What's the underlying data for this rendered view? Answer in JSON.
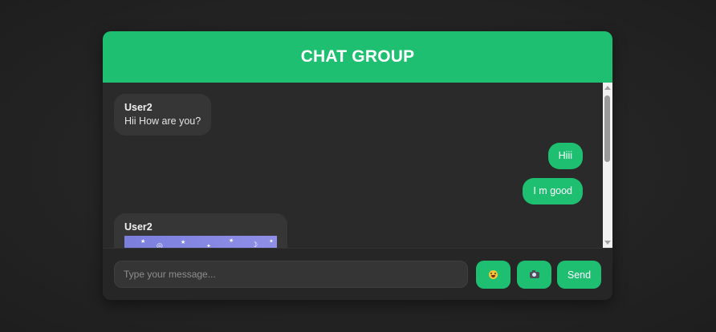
{
  "header": {
    "title": "CHAT GROUP"
  },
  "messages": [
    {
      "direction": "received",
      "sender": "User2",
      "text": "Hii How are you?"
    },
    {
      "direction": "sent",
      "text": "Hiii"
    },
    {
      "direction": "sent",
      "text": "I m good"
    },
    {
      "direction": "received",
      "sender": "User2",
      "type": "image"
    }
  ],
  "composer": {
    "placeholder": "Type your message...",
    "value": "",
    "emoji_icon": "emoji-icon",
    "camera_icon": "camera-icon",
    "send_label": "Send"
  },
  "colors": {
    "accent": "#1fbf72",
    "background": "#2a2a2a",
    "received_bubble": "#363636"
  }
}
